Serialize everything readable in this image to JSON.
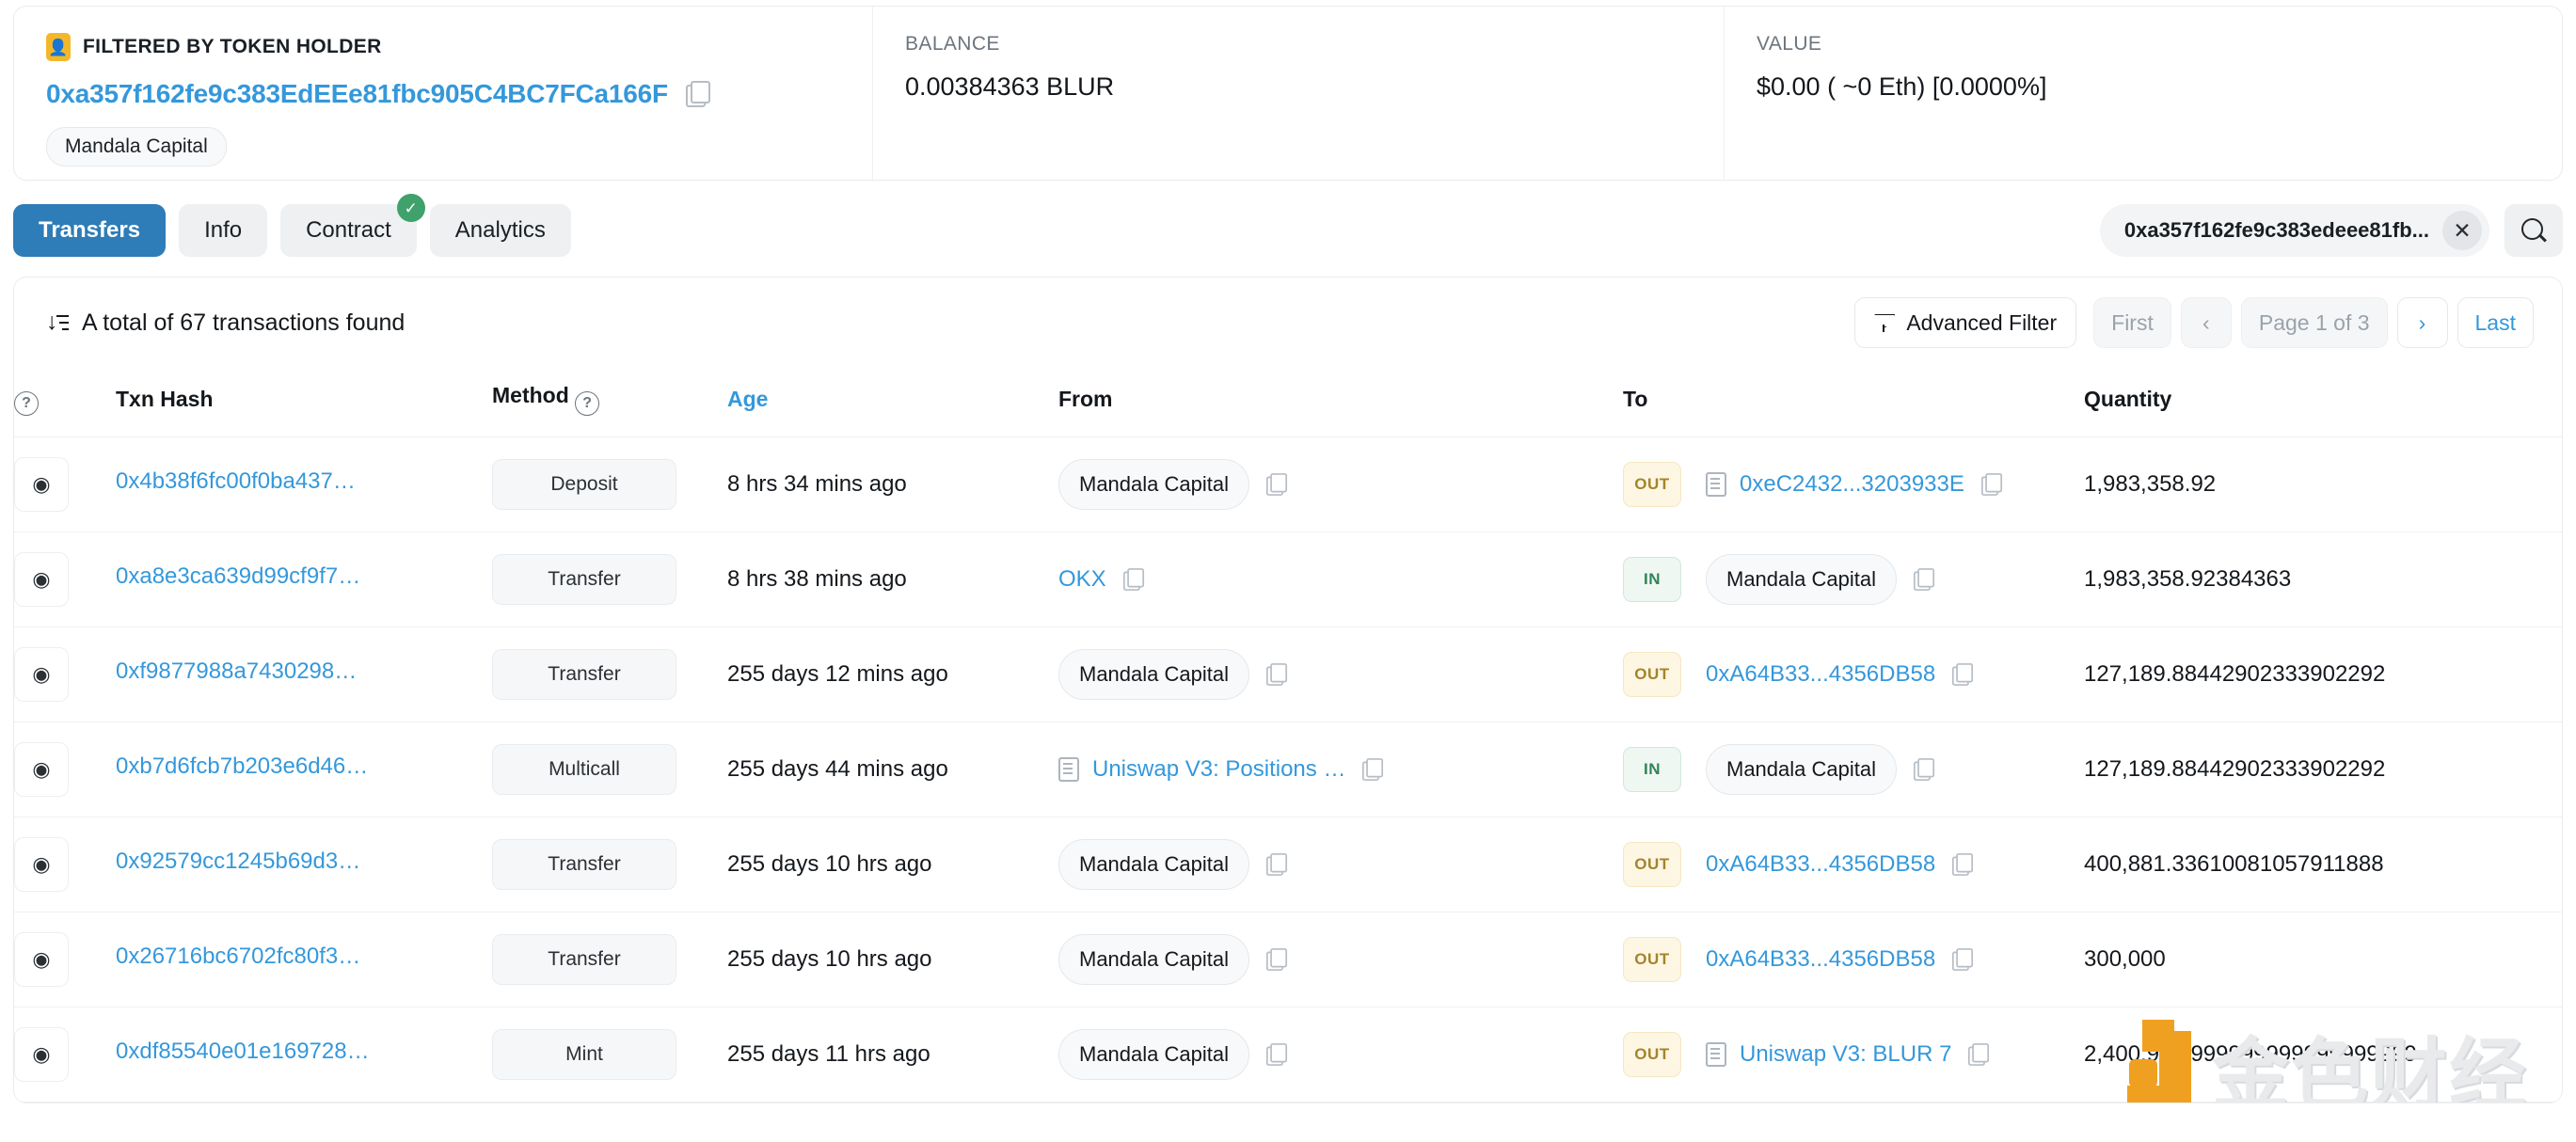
{
  "summary": {
    "filter": {
      "icon": "token-holder-icon",
      "title": "FILTERED BY TOKEN HOLDER",
      "address": "0xa357f162fe9c383EdEEe81fbc905C4BC7FCa166F",
      "tag": "Mandala Capital",
      "copy_icon": "copy-icon"
    },
    "balance": {
      "label": "BALANCE",
      "value": "0.00384363 BLUR"
    },
    "value": {
      "label": "VALUE",
      "value": "$0.00 ( ~0 Eth) [0.0000%]"
    }
  },
  "tabs": [
    {
      "label": "Transfers",
      "active": true,
      "verified": false
    },
    {
      "label": "Info",
      "active": false,
      "verified": false
    },
    {
      "label": "Contract",
      "active": false,
      "verified": true
    },
    {
      "label": "Analytics",
      "active": false,
      "verified": false
    }
  ],
  "search": {
    "value": "0xa357f162fe9c383edeee81fb...",
    "clear_icon": "close-icon",
    "search_icon": "search-icon"
  },
  "toolbar": {
    "sort_icon": "sort-descending-icon",
    "total_text": "A total of 67 transactions found",
    "advanced_filter": "Advanced Filter",
    "filter_icon": "funnel-icon",
    "pager": {
      "first": "First",
      "prev": "‹",
      "page": "Page 1 of 3",
      "next": "›",
      "last": "Last"
    }
  },
  "table": {
    "columns": [
      {
        "key": "info",
        "label": "",
        "help": true
      },
      {
        "key": "hash",
        "label": "Txn Hash",
        "help": false
      },
      {
        "key": "method",
        "label": "Method",
        "help": true
      },
      {
        "key": "age",
        "label": "Age",
        "help": false,
        "sorted": true
      },
      {
        "key": "from",
        "label": "From",
        "help": false
      },
      {
        "key": "to",
        "label": "To",
        "help": false
      },
      {
        "key": "quantity",
        "label": "Quantity",
        "help": false
      }
    ],
    "rows": [
      {
        "eye_icon": "eye-icon",
        "hash": "0x4b38f6fc00f0ba437…",
        "method": "Deposit",
        "age": "8 hrs 34 mins ago",
        "from": {
          "text": "Mandala Capital",
          "style": "pill",
          "contract": false,
          "copy": true
        },
        "direction": "OUT",
        "to": {
          "text": "0xeC2432...3203933E",
          "style": "link",
          "contract": true,
          "copy": true
        },
        "quantity": "1,983,358.92"
      },
      {
        "eye_icon": "eye-icon",
        "hash": "0xa8e3ca639d99cf9f7…",
        "method": "Transfer",
        "age": "8 hrs 38 mins ago",
        "from": {
          "text": "OKX",
          "style": "link",
          "contract": false,
          "copy": true
        },
        "direction": "IN",
        "to": {
          "text": "Mandala Capital",
          "style": "pill",
          "contract": false,
          "copy": true
        },
        "quantity": "1,983,358.92384363"
      },
      {
        "eye_icon": "eye-icon",
        "hash": "0xf9877988a7430298…",
        "method": "Transfer",
        "age": "255 days 12 mins ago",
        "from": {
          "text": "Mandala Capital",
          "style": "pill",
          "contract": false,
          "copy": true
        },
        "direction": "OUT",
        "to": {
          "text": "0xA64B33...4356DB58",
          "style": "link",
          "contract": false,
          "copy": true
        },
        "quantity": "127,189.88442902333902292"
      },
      {
        "eye_icon": "eye-icon",
        "hash": "0xb7d6fcb7b203e6d46…",
        "method": "Multicall",
        "age": "255 days 44 mins ago",
        "from": {
          "text": "Uniswap V3: Positions …",
          "style": "link",
          "contract": true,
          "copy": true
        },
        "direction": "IN",
        "to": {
          "text": "Mandala Capital",
          "style": "pill",
          "contract": false,
          "copy": true
        },
        "quantity": "127,189.88442902333902292"
      },
      {
        "eye_icon": "eye-icon",
        "hash": "0x92579cc1245b69d3…",
        "method": "Transfer",
        "age": "255 days 10 hrs ago",
        "from": {
          "text": "Mandala Capital",
          "style": "pill",
          "contract": false,
          "copy": true
        },
        "direction": "OUT",
        "to": {
          "text": "0xA64B33...4356DB58",
          "style": "link",
          "contract": false,
          "copy": true
        },
        "quantity": "400,881.33610081057911888"
      },
      {
        "eye_icon": "eye-icon",
        "hash": "0x26716bc6702fc80f3…",
        "method": "Transfer",
        "age": "255 days 10 hrs ago",
        "from": {
          "text": "Mandala Capital",
          "style": "pill",
          "contract": false,
          "copy": true
        },
        "direction": "OUT",
        "to": {
          "text": "0xA64B33...4356DB58",
          "style": "link",
          "contract": false,
          "copy": true
        },
        "quantity": "300,000"
      },
      {
        "eye_icon": "eye-icon",
        "hash": "0xdf85540e01e169728…",
        "method": "Mint",
        "age": "255 days 11 hrs ago",
        "from": {
          "text": "Mandala Capital",
          "style": "pill",
          "contract": false,
          "copy": true
        },
        "direction": "OUT",
        "to": {
          "text": "Uniswap V3: BLUR 7",
          "style": "link",
          "contract": true,
          "copy": true
        },
        "quantity": "2,400,999.999999999999999999"
      }
    ]
  },
  "watermark": {
    "text": "金色财经"
  },
  "colors": {
    "accent": "#3498db",
    "active_tab": "#2e7cb8",
    "out_badge": "#a5832a",
    "in_badge": "#2f8457",
    "filter_badge": "#f5b72a",
    "verified": "#3fa16b",
    "watermark": "#f0a020"
  }
}
